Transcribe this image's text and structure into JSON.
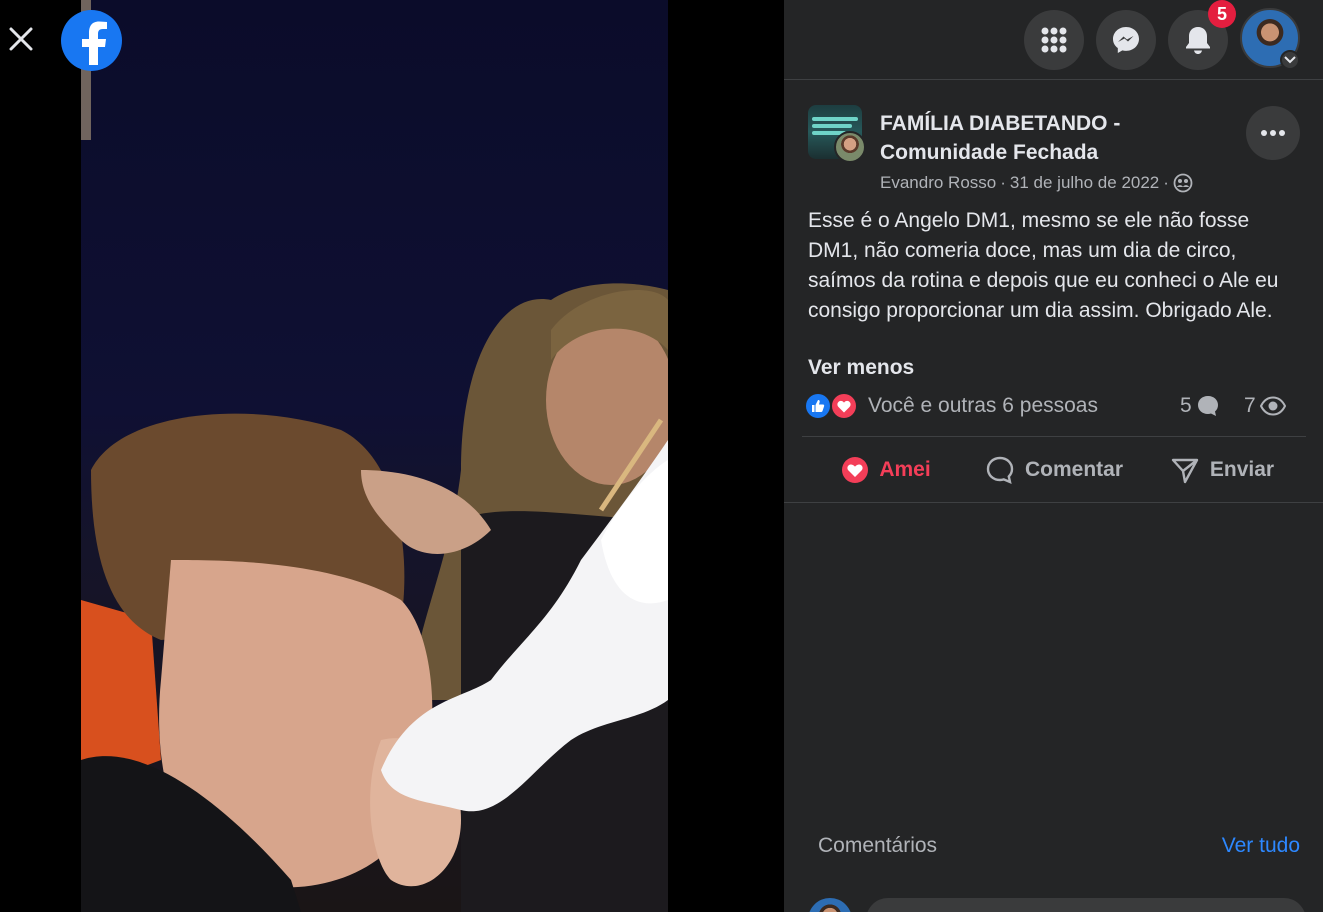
{
  "topbar": {
    "notifications_count": "5",
    "icons": [
      "menu-grid-icon",
      "messenger-icon",
      "bell-icon",
      "profile-avatar"
    ]
  },
  "post": {
    "group_name": "FAMÍLIA DIABETANDO - Comunidade Fechada",
    "author": "Evandro Rosso",
    "separator": "·",
    "date": "31 de julho de 2022",
    "privacy_icon": "group-members-icon",
    "text": "Esse é o Angelo DM1, mesmo se ele não fosse DM1, não comeria doce, mas um dia de circo, saímos da rotina e depois que eu conheci o Ale eu consigo proporcionar um dia assim. Obrigado Ale.",
    "see_less": "Ver menos"
  },
  "reactions": {
    "summary": "Você e outras 6 pessoas",
    "comments_count": "5",
    "views_count": "7"
  },
  "actions": {
    "love": "Amei",
    "comment": "Comentar",
    "share": "Enviar"
  },
  "comments": {
    "title": "Comentários",
    "see_all": "Ver tudo"
  },
  "colors": {
    "panel_bg": "#242526",
    "button_bg": "#3a3b3c",
    "facebook_blue": "#1877f2",
    "love_red": "#f33e58",
    "link_blue": "#2d88ff",
    "badge_red": "#e41e3f"
  }
}
